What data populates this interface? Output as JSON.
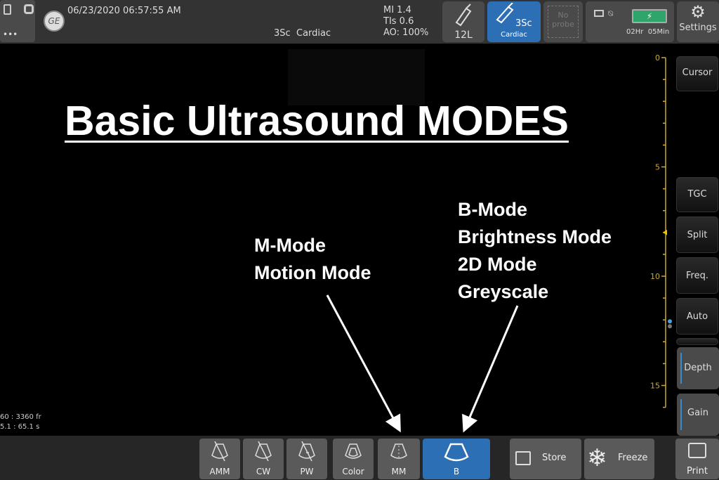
{
  "topbar": {
    "datetime": "06/23/2020 06:57:55 AM",
    "probe_info": "3Sc",
    "preset": "Cardiac",
    "mi": "MI 1.4",
    "tis": "TIs 0.6",
    "ao": "AO: 100%",
    "more": "•••",
    "probes": [
      {
        "label": "12L"
      },
      {
        "label": "3Sc",
        "sub": "Cardiac",
        "active": true
      },
      {
        "label": "No probe"
      }
    ],
    "battery_time": "02Hr  05Min",
    "battery_color": "#2ea56b",
    "settings": "Settings"
  },
  "title": "Basic Ultrasound MODES",
  "annotations": {
    "mmode": [
      "M-Mode",
      "Motion Mode"
    ],
    "bmode": [
      "B-Mode",
      "Brightness Mode",
      "2D Mode",
      "Greyscale"
    ]
  },
  "cine": {
    "frames": "60 : 3360 fr",
    "time": "5.1 : 65.1 s"
  },
  "depth_scale": {
    "labels": [
      "0",
      "5",
      "10",
      "15"
    ],
    "color": "#c9a93a"
  },
  "side": {
    "cursor": "Cursor",
    "tgc": "TGC",
    "split": "Split",
    "freq": "Freq.",
    "auto": "Auto",
    "depth": "Depth",
    "gain": "Gain"
  },
  "modes": [
    {
      "label": "AMM"
    },
    {
      "label": "CW"
    },
    {
      "label": "PW"
    },
    {
      "label": "Color"
    },
    {
      "label": "MM"
    },
    {
      "label": "B",
      "active": true
    }
  ],
  "actions": {
    "store": "Store",
    "freeze": "Freeze",
    "print": "Print"
  },
  "accent": "#2d6fb4"
}
